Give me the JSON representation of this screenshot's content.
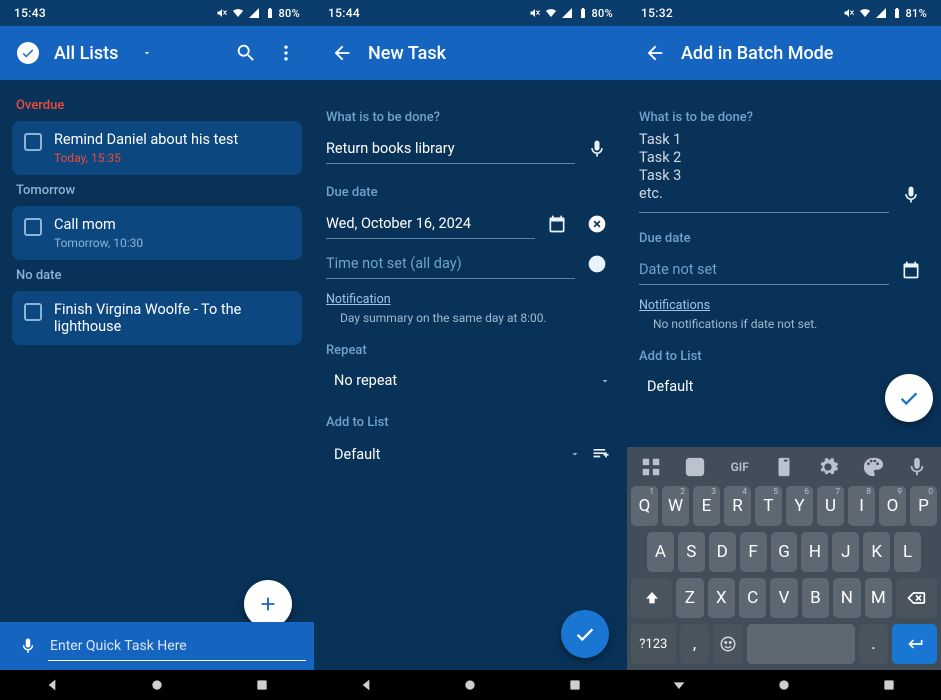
{
  "screen1": {
    "status": {
      "time": "15:43",
      "battery": "80%"
    },
    "appbar": {
      "title": "All Lists"
    },
    "sections": {
      "overdue": {
        "label": "Overdue",
        "task": {
          "title": "Remind Daniel about his test",
          "sub": "Today, 15:35"
        }
      },
      "tomorrow": {
        "label": "Tomorrow",
        "task": {
          "title": "Call mom",
          "sub": "Tomorrow, 10:30"
        }
      },
      "nodate": {
        "label": "No date",
        "task": {
          "title": "Finish Virgina Woolfe - To the lighthouse"
        }
      }
    },
    "quick_placeholder": "Enter Quick Task Here"
  },
  "screen2": {
    "status": {
      "time": "15:44",
      "battery": "80%"
    },
    "appbar": {
      "title": "New Task"
    },
    "labels": {
      "what": "What is to be done?",
      "due": "Due date",
      "repeat": "Repeat",
      "addlist": "Add to List"
    },
    "values": {
      "title": "Return books library",
      "date": "Wed, October 16, 2024",
      "time": "Time not set (all day)",
      "notif_link": "Notification",
      "notif_hint": "Day summary on the same day at 8:00.",
      "repeat": "No repeat",
      "list": "Default"
    }
  },
  "screen3": {
    "status": {
      "time": "15:32",
      "battery": "81%"
    },
    "appbar": {
      "title": "Add in Batch Mode"
    },
    "labels": {
      "what": "What is to be done?",
      "due": "Due date",
      "addlist": "Add to List"
    },
    "values": {
      "lines": [
        "Task 1",
        "Task 2",
        "Task 3",
        "etc."
      ],
      "date": "Date not set",
      "notif_link": "Notifications",
      "notif_hint": "No notifications if date not set.",
      "list": "Default"
    },
    "keyboard": {
      "strip_gif": "GIF",
      "row1": [
        "Q",
        "W",
        "E",
        "R",
        "T",
        "Y",
        "U",
        "I",
        "O",
        "P"
      ],
      "row1_sup": [
        "1",
        "2",
        "3",
        "4",
        "5",
        "6",
        "7",
        "8",
        "9",
        "0"
      ],
      "row2": [
        "A",
        "S",
        "D",
        "F",
        "G",
        "H",
        "J",
        "K",
        "L"
      ],
      "row3": [
        "Z",
        "X",
        "C",
        "V",
        "B",
        "N",
        "M"
      ],
      "sym": "?123",
      "comma": ",",
      "period": "."
    }
  }
}
